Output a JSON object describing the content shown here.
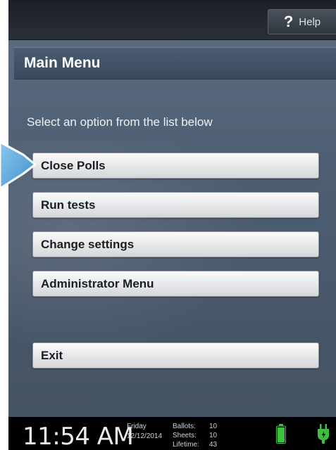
{
  "header": {
    "help_label": "Help",
    "help_icon": "?"
  },
  "page": {
    "title": "Main Menu",
    "instruction": "Select an option from the list below"
  },
  "menu": {
    "items": [
      {
        "label": "Close Polls"
      },
      {
        "label": "Run tests"
      },
      {
        "label": "Change settings"
      },
      {
        "label": "Administrator Menu"
      },
      {
        "label": "Exit"
      }
    ]
  },
  "status": {
    "time": "11:54 AM",
    "day": "Friday",
    "date": "12/12/2014",
    "ballots_label": "Ballots:",
    "ballots": "10",
    "sheets_label": "Sheets:",
    "sheets": "10",
    "lifetime_label": "Lifetime:",
    "lifetime": "43",
    "battery_level": 1.0,
    "battery_icon": "battery-icon",
    "power_icon": "power-plug-icon"
  },
  "colors": {
    "accent_arrow": "#5ea9dc",
    "battery_green": "#3fbf3f",
    "title_bar": "#3f4f63"
  }
}
